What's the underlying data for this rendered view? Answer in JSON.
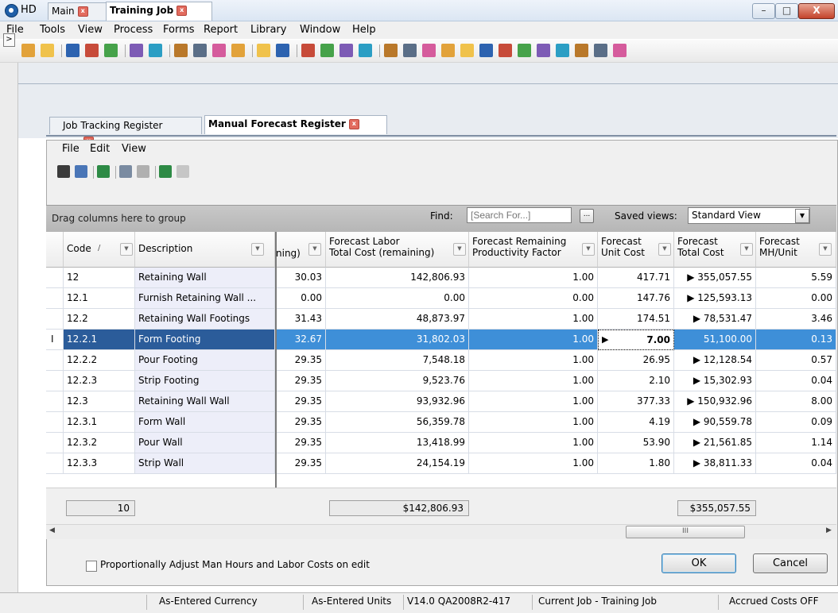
{
  "window": {
    "title": "HD",
    "minimize": "–",
    "maximize": "□",
    "close": "X"
  },
  "menubar": [
    "File",
    "Tools",
    "View",
    "Process",
    "Forms",
    "Report",
    "Library",
    "Window",
    "Help"
  ],
  "side": {
    "expand": ">"
  },
  "tabs_top": [
    {
      "label": "Main"
    },
    {
      "label": "Training Job"
    }
  ],
  "tabs_sub": [
    {
      "label": "Job Tracking Register"
    },
    {
      "label": "Manual Forecast Register"
    }
  ],
  "inner_menu": [
    "File",
    "Edit",
    "View"
  ],
  "groupbar": {
    "hint": "Drag columns here to group",
    "find_label": "Find:",
    "find_placeholder": "[Search For...]",
    "find_btn": "...",
    "saved_label": "Saved views:",
    "saved_value": "Standard View",
    "saved_arrow": "▼"
  },
  "columns": {
    "code": "Code",
    "sort": "/",
    "description": "Description",
    "partial": "ning)",
    "fltc_1": "Forecast Labor",
    "fltc_2": "Total Cost (remaining)",
    "frpf_1": "Forecast Remaining",
    "frpf_2": "Productivity Factor",
    "fuc_1": "Forecast",
    "fuc_2": "Unit Cost",
    "ftc_1": "Forecast",
    "ftc_2": "Total Cost",
    "fmh_1": "Forecast",
    "fmh_2": "MH/Unit"
  },
  "rows": [
    {
      "code": "12",
      "description": "Retaining Wall",
      "partial": "30.03",
      "labor_total": "142,806.93",
      "prod_factor": "1.00",
      "unit_cost": "417.71",
      "total_cost": "▶ 355,057.55",
      "mh_unit": "5.59"
    },
    {
      "code": "12.1",
      "description": "Furnish Retaining Wall ...",
      "partial": "0.00",
      "labor_total": "0.00",
      "prod_factor": "0.00",
      "unit_cost": "147.76",
      "total_cost": "▶ 125,593.13",
      "mh_unit": "0.00"
    },
    {
      "code": "12.2",
      "description": "Retaining Wall Footings",
      "partial": "31.43",
      "labor_total": "48,873.97",
      "prod_factor": "1.00",
      "unit_cost": "174.51",
      "total_cost": "▶  78,531.47",
      "mh_unit": "3.46"
    },
    {
      "code": "12.2.1",
      "description": "Form Footing",
      "partial": "32.67",
      "labor_total": "31,802.03",
      "prod_factor": "1.00",
      "unit_cost": "7.00",
      "total_cost": "51,100.00",
      "mh_unit": "0.13"
    },
    {
      "code": "12.2.2",
      "description": "Pour Footing",
      "partial": "29.35",
      "labor_total": "7,548.18",
      "prod_factor": "1.00",
      "unit_cost": "26.95",
      "total_cost": "▶  12,128.54",
      "mh_unit": "0.57"
    },
    {
      "code": "12.2.3",
      "description": "Strip Footing",
      "partial": "29.35",
      "labor_total": "9,523.76",
      "prod_factor": "1.00",
      "unit_cost": "2.10",
      "total_cost": "▶  15,302.93",
      "mh_unit": "0.04"
    },
    {
      "code": "12.3",
      "description": "Retaining Wall Wall",
      "partial": "29.35",
      "labor_total": "93,932.96",
      "prod_factor": "1.00",
      "unit_cost": "377.33",
      "total_cost": "▶ 150,932.96",
      "mh_unit": "8.00"
    },
    {
      "code": "12.3.1",
      "description": "Form Wall",
      "partial": "29.35",
      "labor_total": "56,359.78",
      "prod_factor": "1.00",
      "unit_cost": "4.19",
      "total_cost": "▶  90,559.78",
      "mh_unit": "0.09"
    },
    {
      "code": "12.3.2",
      "description": "Pour Wall",
      "partial": "29.35",
      "labor_total": "13,418.99",
      "prod_factor": "1.00",
      "unit_cost": "53.90",
      "total_cost": "▶  21,561.85",
      "mh_unit": "1.14"
    },
    {
      "code": "12.3.3",
      "description": "Strip Wall",
      "partial": "29.35",
      "labor_total": "24,154.19",
      "prod_factor": "1.00",
      "unit_cost": "1.80",
      "total_cost": "▶  38,811.33",
      "mh_unit": "0.04"
    }
  ],
  "selected_row": {
    "row_marker": "I",
    "cursor_marker": "▶"
  },
  "totals": {
    "count": "10",
    "labor_total": "$142,806.93",
    "total_cost": "$355,057.55"
  },
  "hscroll": {
    "grip": "III",
    "left": "◀",
    "right": "▶"
  },
  "footer": {
    "checkbox_label": "Proportionally Adjust Man Hours and Labor Costs on edit",
    "checkbox_checked": false,
    "ok": "OK",
    "cancel": "Cancel"
  },
  "status": {
    "currency": "As-Entered Currency",
    "units": "As-Entered Units",
    "version": "V14.0 QA2008R2-417",
    "job": "Current Job - Training Job",
    "accrued": "Accrued Costs OFF"
  },
  "colors": {
    "selected_row": "#3e8fd8",
    "selected_code": "#2b5c9a",
    "frozen_col_bg": "#edeef9",
    "close_btn": "#c4432b"
  },
  "toolbar_icons": [
    "open-folder-icon",
    "open-icon",
    "save-icon",
    "save-all-icon",
    "project-icon",
    "triangle-icon",
    "tree-icon",
    "folder-edit-icon",
    "chart-icon",
    "grid-icon",
    "network-icon",
    "document-icon",
    "org-icon",
    "mail-icon",
    "comment-icon",
    "approve-icon",
    "flag-icon",
    "gantt-icon",
    "line-chart-icon",
    "export-icon",
    "clipboard-icon",
    "target-icon",
    "crosshair-icon",
    "money-icon",
    "tools-icon",
    "settings-icon",
    "mountain-icon",
    "pencil-icon",
    "book-icon",
    "excel-icon"
  ],
  "inner_toolbar_icons": [
    "print-icon",
    "print-preview-icon",
    "export-excel-icon",
    "copy-icon",
    "paste-icon",
    "excel-icon",
    "excel-disabled-icon"
  ]
}
